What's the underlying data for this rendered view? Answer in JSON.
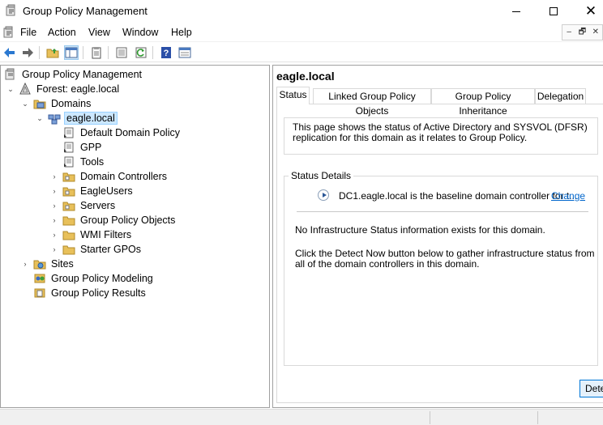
{
  "window": {
    "title": "Group Policy Management"
  },
  "menu": {
    "items": [
      "File",
      "Action",
      "View",
      "Window",
      "Help"
    ]
  },
  "toolbar": {
    "icons": [
      "back-arrow",
      "forward-arrow",
      "up-folder",
      "show-hide-tree",
      "properties",
      "export-list",
      "refresh",
      "help",
      "console-view"
    ]
  },
  "tree": {
    "nodes": [
      {
        "label": "Group Policy Management",
        "icon": "gpm-icon"
      },
      {
        "label": "Forest: eagle.local",
        "icon": "forest-icon"
      },
      {
        "label": "Domains",
        "icon": "domains-icon"
      },
      {
        "label": "eagle.local",
        "icon": "domain-icon"
      },
      {
        "label": "Default Domain Policy",
        "icon": "gpo-link-icon"
      },
      {
        "label": "GPP",
        "icon": "gpo-link-icon"
      },
      {
        "label": "Tools",
        "icon": "gpo-link-icon"
      },
      {
        "label": "Domain Controllers",
        "icon": "ou-icon"
      },
      {
        "label": "EagleUsers",
        "icon": "ou-icon"
      },
      {
        "label": "Servers",
        "icon": "ou-icon"
      },
      {
        "label": "Group Policy Objects",
        "icon": "folder-icon"
      },
      {
        "label": "WMI Filters",
        "icon": "folder-icon"
      },
      {
        "label": "Starter GPOs",
        "icon": "folder-icon"
      },
      {
        "label": "Sites",
        "icon": "sites-icon"
      },
      {
        "label": "Group Policy Modeling",
        "icon": "modeling-icon"
      },
      {
        "label": "Group Policy Results",
        "icon": "results-icon"
      }
    ]
  },
  "details": {
    "title": "eagle.local",
    "tabs": [
      "Status",
      "Linked Group Policy Objects",
      "Group Policy Inheritance",
      "Delegation"
    ],
    "active_tab": "Status",
    "info_text": "This page shows the status of Active Directory and SYSVOL (DFSR) replication for this domain as it relates to Group Policy.",
    "status_details_label": "Status Details",
    "baseline_text": "DC1.eagle.local is the baseline domain controller for t...",
    "change_link": "Change",
    "no_infra_text": "No Infrastructure Status information exists for this domain.",
    "detect_hint": "Click the Detect Now button below to gather infrastructure status from all of the domain controllers in this domain.",
    "detect_button": "Dete"
  }
}
